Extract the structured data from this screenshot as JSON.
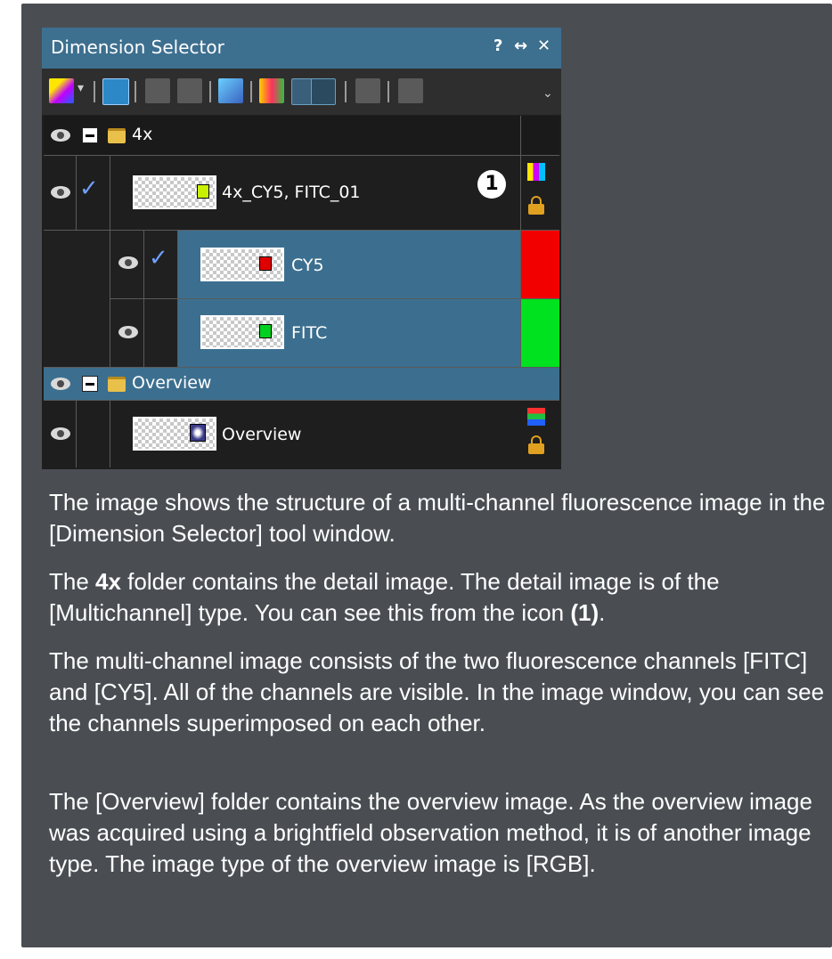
{
  "window": {
    "title": "Dimension Selector",
    "help_btn": "?",
    "pin_btn": "↔",
    "close_btn": "✕"
  },
  "toolbar": {
    "buttons": [
      "color-mode",
      "multichannel-view",
      "disabled-1",
      "disabled-2",
      "show-fluorescence",
      "channel-overlay",
      "channel-split",
      "disabled-3",
      "disabled-4"
    ]
  },
  "tree": {
    "folder_4x": "4x",
    "multichannel_image": "4x_CY5, FITC_01",
    "channel_cy5": "CY5",
    "channel_fitc": "FITC",
    "folder_overview": "Overview",
    "overview_image": "Overview",
    "badge": "1"
  },
  "colors": {
    "cy5": "#f20000",
    "fitc": "#00e11f",
    "selected_row": "#3c6f8f",
    "title_bar": "#3d6f8f"
  },
  "text": {
    "p1": "The image shows the structure of a multi-channel fluorescence image in the [Dimension Selector] tool window.",
    "p2_a": "The ",
    "p2_b": "4x",
    "p2_c": " folder contains the detail image. The detail image is of the [Multichannel] type. You can see this from the icon ",
    "p2_d": "(1)",
    "p2_e": ".",
    "p3": "The multi-channel image consists of the two fluorescence channels [FITC] and [CY5]. All of the channels are visible. In the image window, you can see the channels superimposed on each other.",
    "p4": "The [Overview] folder contains the overview image. As the overview image was acquired using a brightfield observation method, it is of another image type. The image type of the overview image is [RGB]."
  }
}
